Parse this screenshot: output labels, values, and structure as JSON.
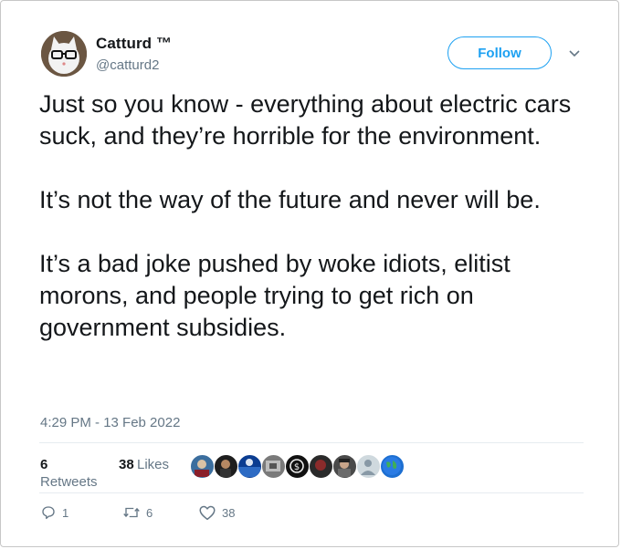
{
  "author": {
    "display_name": "Catturd ™",
    "handle": "@catturd2"
  },
  "follow_label": "Follow",
  "tweet": {
    "text": "Just so you know - everything about electric cars suck, and they’re horrible for the environment.\n\nIt’s not the way of the future and never will be.\n\nIt’s a bad joke pushed by woke idiots, elitist morons, and people trying to get rich on government subsidies.",
    "timestamp": "4:29 PM - 13 Feb 2022"
  },
  "stats": {
    "retweets_count": "6",
    "retweets_label": "Retweets",
    "likes_count": "38",
    "likes_label": "Likes"
  },
  "actions": {
    "reply_count": "1",
    "retweet_count": "6",
    "like_count": "38"
  },
  "colors": {
    "accent": "#1da1f2",
    "muted": "#657786",
    "text": "#14171a"
  },
  "likers": [
    "liker-avatar-1",
    "liker-avatar-2",
    "liker-avatar-3",
    "liker-avatar-4",
    "liker-avatar-5",
    "liker-avatar-6",
    "liker-avatar-7",
    "liker-avatar-8",
    "liker-avatar-9"
  ]
}
